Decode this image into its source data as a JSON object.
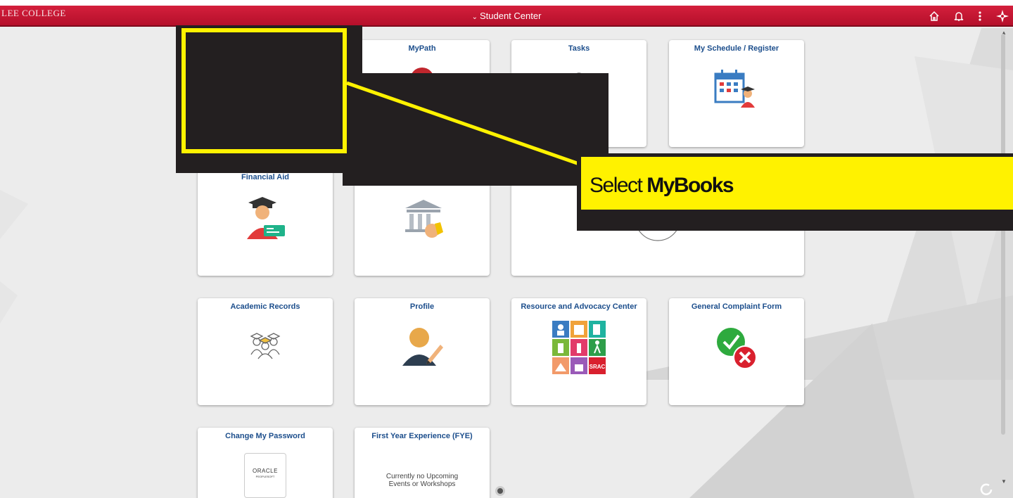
{
  "header": {
    "logo_text": "LEE COLLEGE",
    "title": "Student Center",
    "icons": [
      "home-icon",
      "bell-icon",
      "more-vertical-icon",
      "navbar-compass-icon"
    ],
    "bar_color": "#c8102e"
  },
  "tiles": [
    {
      "title": "MyPath",
      "icon": "alert-icon"
    },
    {
      "title": "Tasks",
      "icon": "tasks-icon"
    },
    {
      "title": "My Schedule / Register",
      "icon": "calendar-student-icon"
    },
    {
      "title": "Financial Aid",
      "icon": "graduate-money-icon"
    },
    {
      "title": "",
      "icon": "bank-money-icon"
    },
    {
      "title": "",
      "icon": "circle-icon"
    },
    {
      "title": "Academic Records",
      "icon": "graduates-group-icon"
    },
    {
      "title": "Profile",
      "icon": "user-edit-icon"
    },
    {
      "title": "Resource and Advocacy Center",
      "icon": "srac-grid-icon",
      "badge": "SRAC"
    },
    {
      "title": "General Complaint Form",
      "icon": "check-cross-icon"
    },
    {
      "title": "Change My Password",
      "icon": "oracle-peoplesoft-icon",
      "logo_lines": [
        "ORACLE",
        "PEOPLESOFT"
      ]
    },
    {
      "title": "First Year Experience (FYE)",
      "text_lines": [
        "Currently no Upcoming",
        "Events or Workshops"
      ]
    }
  ],
  "callout": {
    "prefix": "Select ",
    "bold": "MyBooks",
    "color": "#fff200"
  }
}
